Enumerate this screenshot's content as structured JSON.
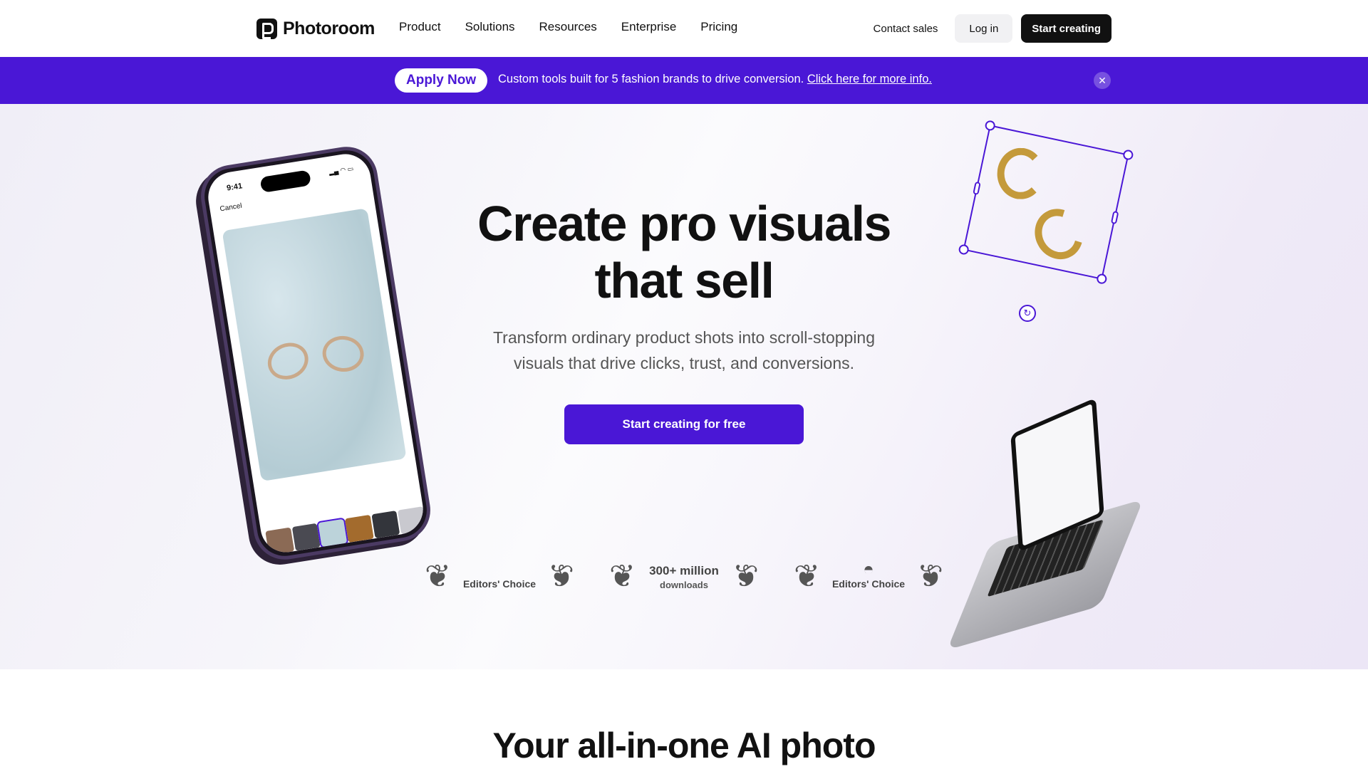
{
  "nav": {
    "logo_text": "Photoroom",
    "menu": [
      "Product",
      "Solutions",
      "Resources",
      "Enterprise",
      "Pricing"
    ],
    "contact_label": "Contact sales",
    "login_label": "Log in",
    "start_label": "Start creating"
  },
  "banner": {
    "apply_label": "Apply Now",
    "message": "Custom tools built for 5 fashion brands to drive conversion. ",
    "link_text": "Click here for more info.",
    "close_icon": "close-icon",
    "bg_color": "#4a17d6"
  },
  "hero": {
    "title_line1": "Create pro visuals",
    "title_line2": "that sell",
    "subtitle_line1": "Transform ordinary product shots into scroll-stopping",
    "subtitle_line2": "visuals that drive clicks, trust, and conversions.",
    "cta_label": "Start creating for free",
    "accent_color": "#4a17d6"
  },
  "phone": {
    "time": "9:41",
    "cancel_label": "Cancel"
  },
  "awards": [
    {
      "icon": "apple-icon",
      "label": "Editors' Choice"
    },
    {
      "big": "300+ million",
      "small": "downloads"
    },
    {
      "icon": "android-icon",
      "label": "Editors' Choice"
    }
  ],
  "section": {
    "title": "Your all-in-one AI photo"
  }
}
